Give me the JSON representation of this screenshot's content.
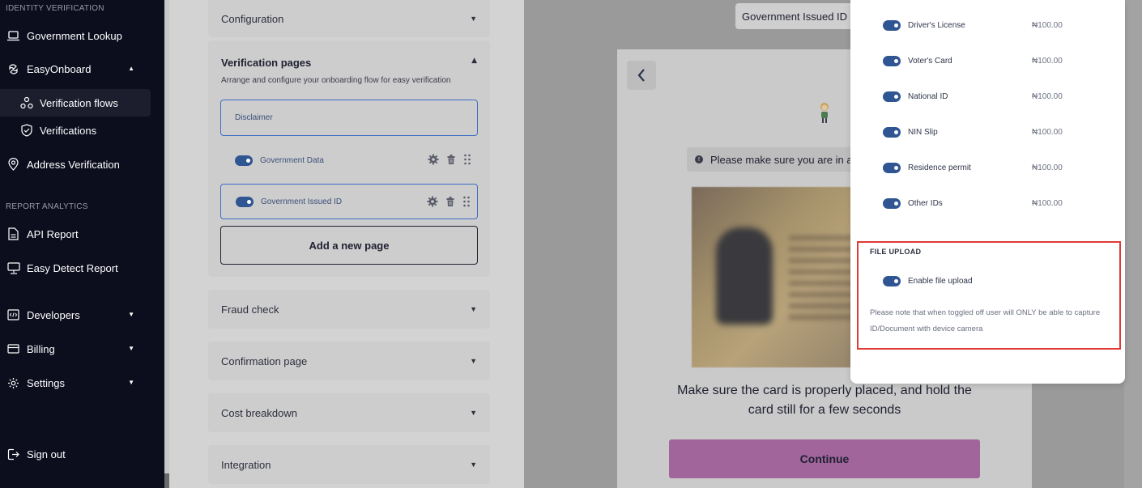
{
  "sidebar": {
    "sections": [
      "IDENTITY VERIFICATION",
      "REPORT ANALYTICS"
    ],
    "items": [
      {
        "label": "Government Lookup"
      },
      {
        "label": "EasyOnboard"
      },
      {
        "label": "Verification flows"
      },
      {
        "label": "Verifications"
      },
      {
        "label": "Address Verification"
      },
      {
        "label": "API Report"
      },
      {
        "label": "Easy Detect Report"
      },
      {
        "label": "Developers"
      },
      {
        "label": "Billing"
      },
      {
        "label": "Settings"
      },
      {
        "label": "Sign out"
      }
    ]
  },
  "config": {
    "configuration_label": "Configuration",
    "verification_pages": {
      "title": "Verification pages",
      "subtitle": "Arrange and configure your onboarding flow for easy verification",
      "disclaimer": "Disclaimer",
      "pages": [
        {
          "label": "Government Data",
          "enabled": true
        },
        {
          "label": "Government Issued ID",
          "enabled": true
        }
      ],
      "add_page_label": "Add a new page"
    },
    "sections": [
      "Fraud check",
      "Confirmation page",
      "Cost breakdown",
      "Integration"
    ]
  },
  "preview": {
    "tab_label": "Government Issued ID",
    "notice": "Please make sure you are in a",
    "instruction": "Make sure the card is properly placed, and hold the card still for a few seconds",
    "continue_label": "Continue"
  },
  "id_options": {
    "items": [
      {
        "label": "Driver's License",
        "price": "₦100.00",
        "enabled": true
      },
      {
        "label": "Voter's Card",
        "price": "₦100.00",
        "enabled": true
      },
      {
        "label": "National ID",
        "price": "₦100.00",
        "enabled": true
      },
      {
        "label": "NIN Slip",
        "price": "₦100.00",
        "enabled": true
      },
      {
        "label": "Residence permit",
        "price": "₦100.00",
        "enabled": true
      },
      {
        "label": "Other IDs",
        "price": "₦100.00",
        "enabled": true
      }
    ],
    "file_upload": {
      "title": "FILE UPLOAD",
      "toggle_label": "Enable file upload",
      "enabled": true,
      "note": "Please note that when toggled off user will ONLY be able to capture ID/Document with device camera"
    }
  },
  "colors": {
    "sidebar_bg": "#0c0d1d",
    "toggle_on": "#2f5593",
    "highlight_border": "#e03a34",
    "continue_button": "#a1659c",
    "selected_border": "#3c6ec6"
  }
}
